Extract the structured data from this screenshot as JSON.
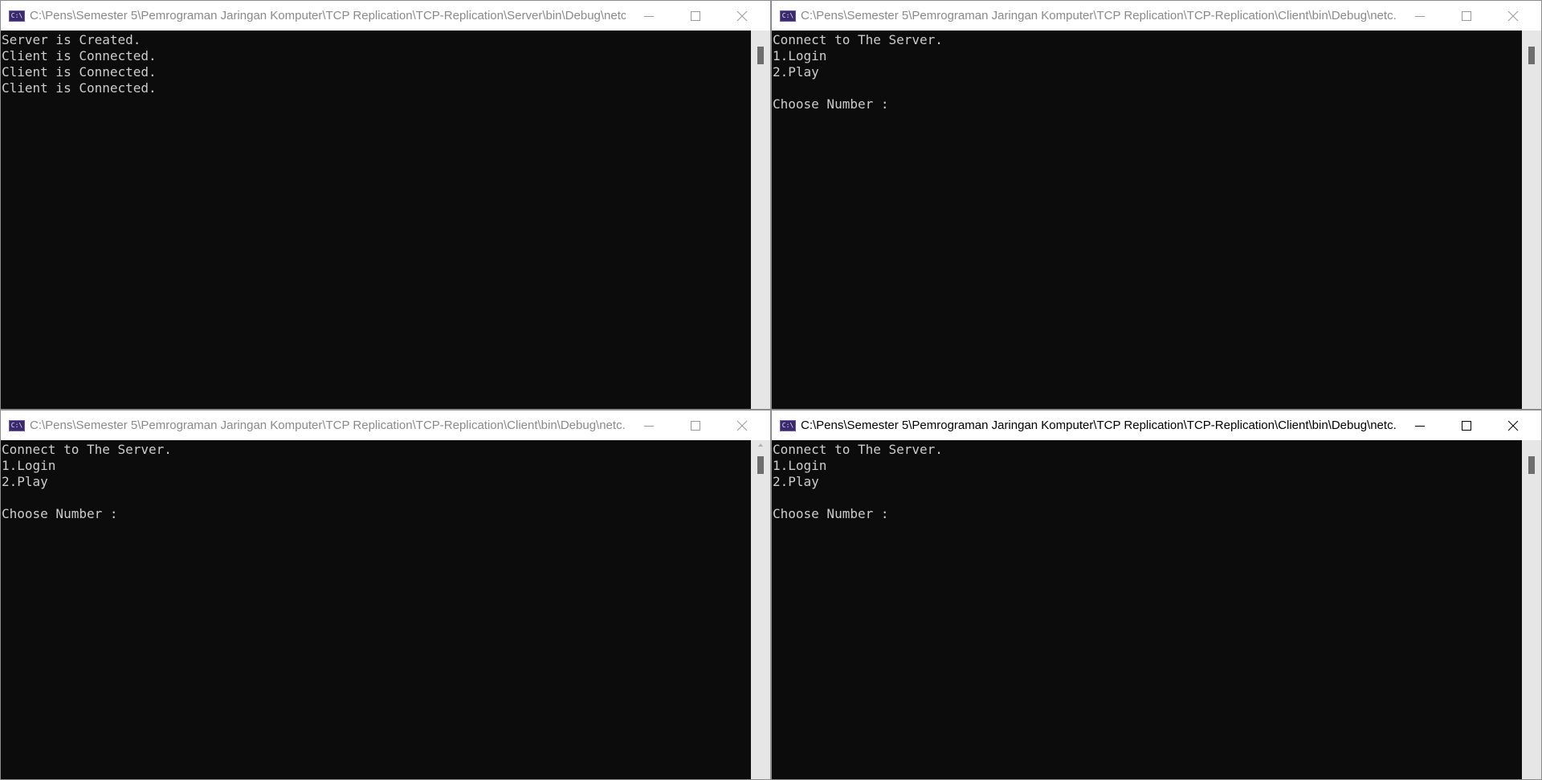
{
  "windows": [
    {
      "title": "C:\\Pens\\Semester 5\\Pemrograman Jaringan Komputer\\TCP Replication\\TCP-Replication\\Server\\bin\\Debug\\netc...",
      "lines": [
        "Server is Created.",
        "Client is Connected.",
        "Client is Connected.",
        "Client is Connected."
      ]
    },
    {
      "title": "C:\\Pens\\Semester 5\\Pemrograman Jaringan Komputer\\TCP Replication\\TCP-Replication\\Client\\bin\\Debug\\netc...",
      "lines": [
        "Connect to The Server.",
        "1.Login",
        "2.Play",
        "",
        "Choose Number :"
      ]
    },
    {
      "title": "C:\\Pens\\Semester 5\\Pemrograman Jaringan Komputer\\TCP Replication\\TCP-Replication\\Client\\bin\\Debug\\netc...",
      "lines": [
        "Connect to The Server.",
        "1.Login",
        "2.Play",
        "",
        "Choose Number :"
      ]
    },
    {
      "title": "C:\\Pens\\Semester 5\\Pemrograman Jaringan Komputer\\TCP Replication\\TCP-Replication\\Client\\bin\\Debug\\netc...",
      "lines": [
        "Connect to The Server.",
        "1.Login",
        "2.Play",
        "",
        "Choose Number :"
      ]
    }
  ],
  "icons": {
    "app": "console-app-icon",
    "minimize": "minimize-icon",
    "maximize": "maximize-icon",
    "close": "close-icon"
  },
  "colors": {
    "console_bg": "#0c0c0c",
    "console_text": "#cccccc",
    "titlebar_bg": "#ffffff",
    "inactive_title": "#8a8a8a",
    "active_title": "#000000"
  }
}
